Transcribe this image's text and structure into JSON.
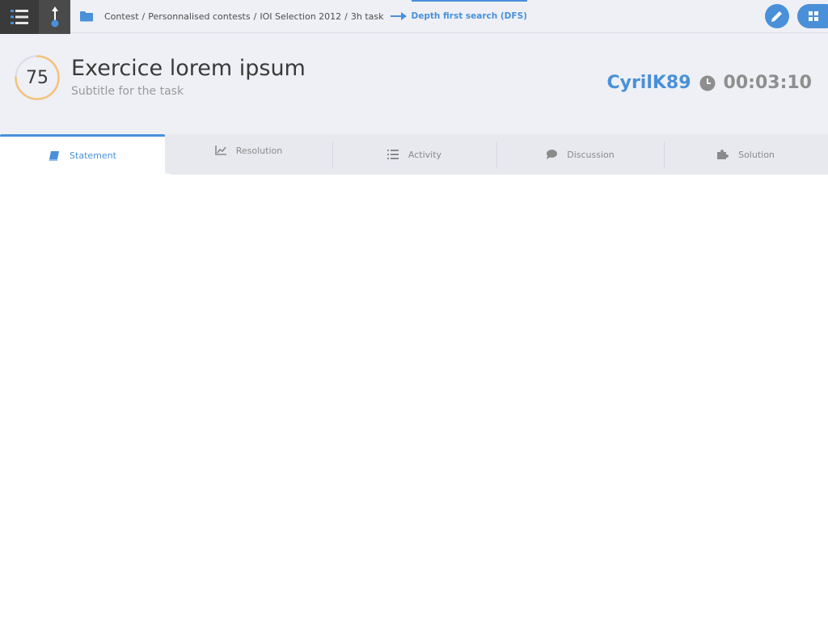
{
  "breadcrumb": {
    "items": [
      "Contest",
      "Personnalised contests",
      "IOI Selection 2012",
      "3h task"
    ],
    "separator": "/",
    "current": "Depth first search (DFS)"
  },
  "task": {
    "score": "75",
    "title": "Exercice lorem ipsum",
    "subtitle": "Subtitle for the task"
  },
  "user": {
    "name": "CyrilK89",
    "timer": "00:03:10"
  },
  "tabs": [
    {
      "label": "Statement",
      "icon": "book-icon",
      "active": true
    },
    {
      "label": "Resolution",
      "icon": "chart-icon",
      "active": false
    },
    {
      "label": "Activity",
      "icon": "list-icon",
      "active": false
    },
    {
      "label": "Discussion",
      "icon": "comment-icon",
      "active": false
    },
    {
      "label": "Solution",
      "icon": "puzzle-icon",
      "active": false
    }
  ],
  "colors": {
    "accent": "#4a90d9",
    "score_ring": "#f5c27a",
    "header_bg": "#eef0f5",
    "dark_button": "#3a3a3a"
  }
}
